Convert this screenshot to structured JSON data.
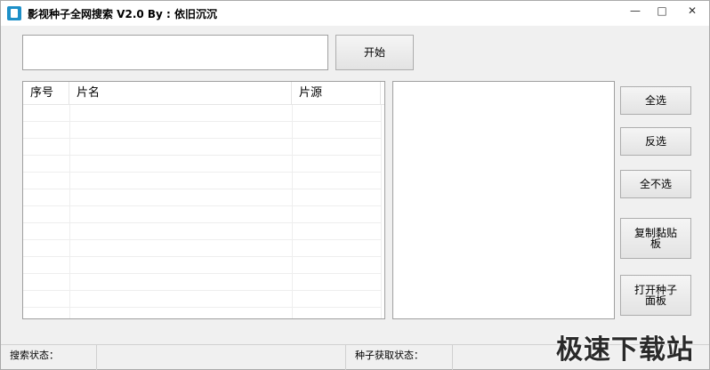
{
  "window": {
    "title": "影视种子全网搜索 V2.0 By : 依旧沉沉",
    "controls": {
      "minimize": "—",
      "maximize": "□",
      "close": "✕"
    }
  },
  "search": {
    "value": "",
    "start_label": "开始"
  },
  "results": {
    "columns": [
      "序号",
      "片名",
      "片源"
    ],
    "rows": []
  },
  "buttons": {
    "select_all": "全选",
    "invert": "反选",
    "select_none": "全不选",
    "copy_clipboard": "复制黏贴板",
    "open_panel": "打开种子面板"
  },
  "status": {
    "search_status": "搜索状态：",
    "seed_status": "种子获取状态："
  },
  "watermark": "极速下载站",
  "colors": {
    "icon_accent": "#1e90c8",
    "window_bg": "#f0f0f0"
  },
  "icons": [
    "app-icon",
    "minimize-icon",
    "maximize-icon",
    "close-icon"
  ]
}
